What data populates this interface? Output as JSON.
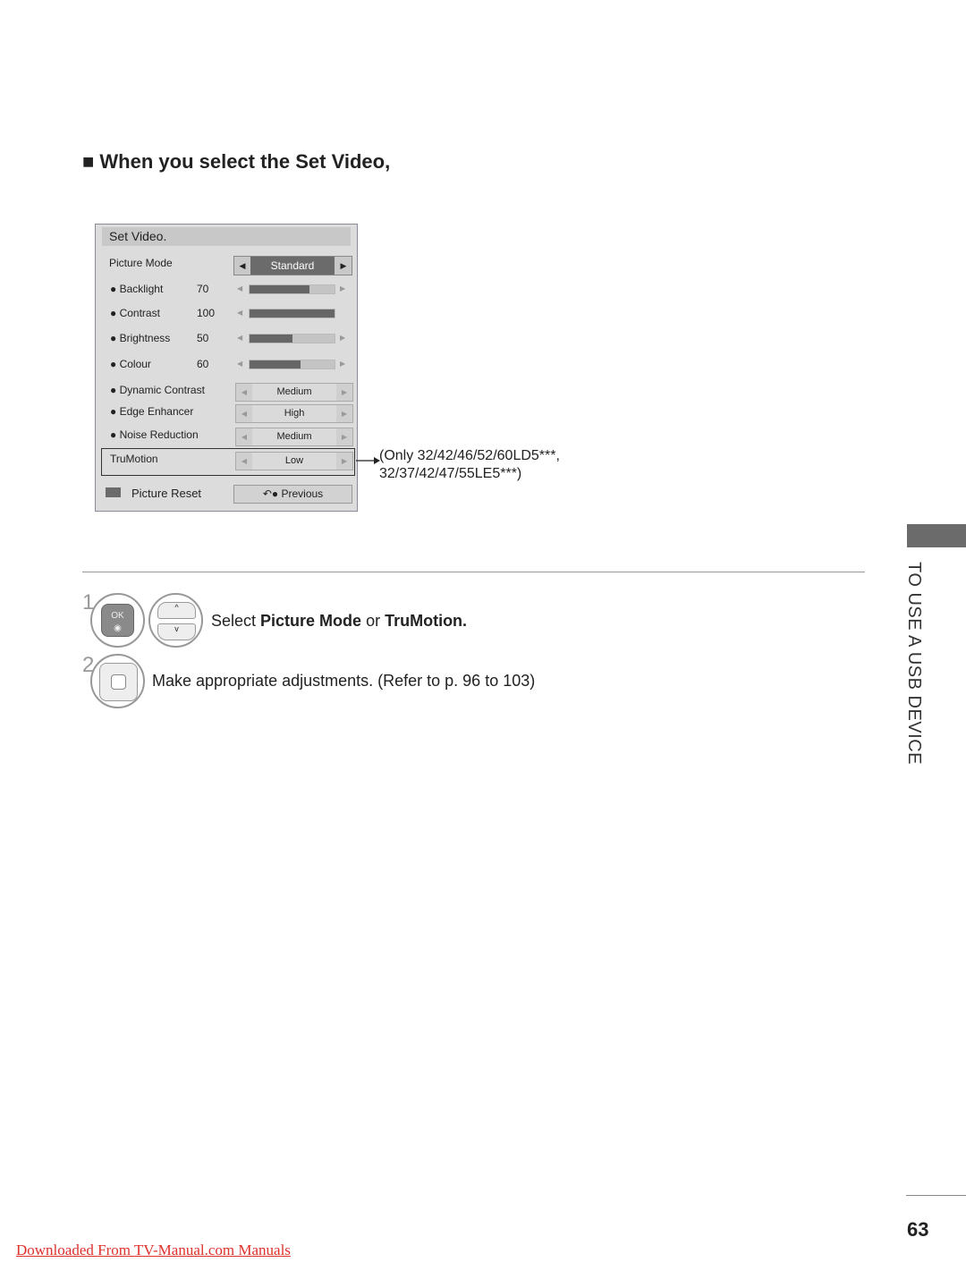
{
  "heading": "■ When you select the Set Video,",
  "menu": {
    "title": "Set Video.",
    "picture_mode": {
      "label": "Picture Mode",
      "value": "Standard"
    },
    "sliders": [
      {
        "label": "● Backlight",
        "value": "70",
        "level": 70,
        "right_arrow": true
      },
      {
        "label": "● Contrast",
        "value": "100",
        "level": 100,
        "right_arrow": false
      },
      {
        "label": "● Brightness",
        "value": "50",
        "level": 50,
        "right_arrow": true
      },
      {
        "label": "● Colour",
        "value": "60",
        "level": 60,
        "right_arrow": true
      }
    ],
    "options": [
      {
        "label": "● Dynamic Contrast",
        "value": "Medium"
      },
      {
        "label": "● Edge Enhancer",
        "value": "High"
      },
      {
        "label": "● Noise Reduction",
        "value": "Medium"
      }
    ],
    "trumotion": {
      "label": "TruMotion",
      "value": "Low"
    },
    "reset_label": "Picture Reset",
    "previous_label": "Previous"
  },
  "note": {
    "line1": "(Only 32/42/46/52/60LD5***,",
    "line2": "32/37/42/47/55LE5***)"
  },
  "steps": [
    {
      "num": "1",
      "pre": "Select ",
      "b1": "Picture Mode",
      "mid": " or ",
      "b2": "TruMotion."
    },
    {
      "num": "2",
      "text": "Make appropriate adjustments. (Refer to p. 96 to 103)"
    }
  ],
  "ok_label": "OK",
  "side_title": "TO USE A USB DEVICE",
  "page_number": "63",
  "footer_link": "Downloaded From TV-Manual.com Manuals"
}
